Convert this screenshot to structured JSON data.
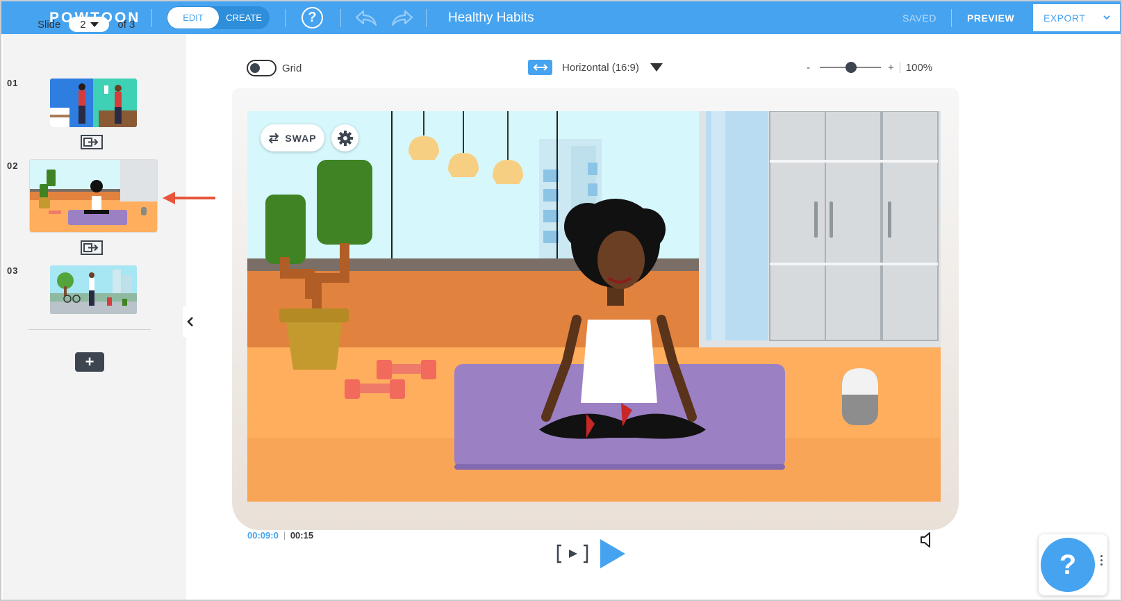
{
  "topbar": {
    "logo": "POWTOON",
    "mode_edit": "EDIT",
    "mode_create": "CREATE",
    "help_glyph": "?",
    "project_title": "Healthy Habits",
    "saved_label": "SAVED",
    "preview_label": "PREVIEW",
    "export_label": "EXPORT"
  },
  "sidebar": {
    "slide_label": "Slide",
    "current_slide": "2",
    "of_label": "of 3",
    "slides": [
      {
        "number": "01",
        "name": "kitchen-scene"
      },
      {
        "number": "02",
        "name": "yoga-scene"
      },
      {
        "number": "03",
        "name": "park-scene"
      }
    ],
    "add_label": "+"
  },
  "canvas_toolbar": {
    "grid_label": "Grid",
    "orientation_label": "Horizontal (16:9)",
    "zoom_minus": "-",
    "zoom_plus": "+",
    "zoom_value": "100%",
    "zoom_level_percent": 100
  },
  "stage": {
    "swap_label": "SWAP"
  },
  "playback": {
    "current_time": "00:09:0",
    "total_time": "00:15"
  },
  "help_fab": {
    "glyph": "?"
  },
  "colors": {
    "brand_blue": "#46a3f0",
    "dark": "#3d4551",
    "arrow_red": "#e8553a"
  }
}
